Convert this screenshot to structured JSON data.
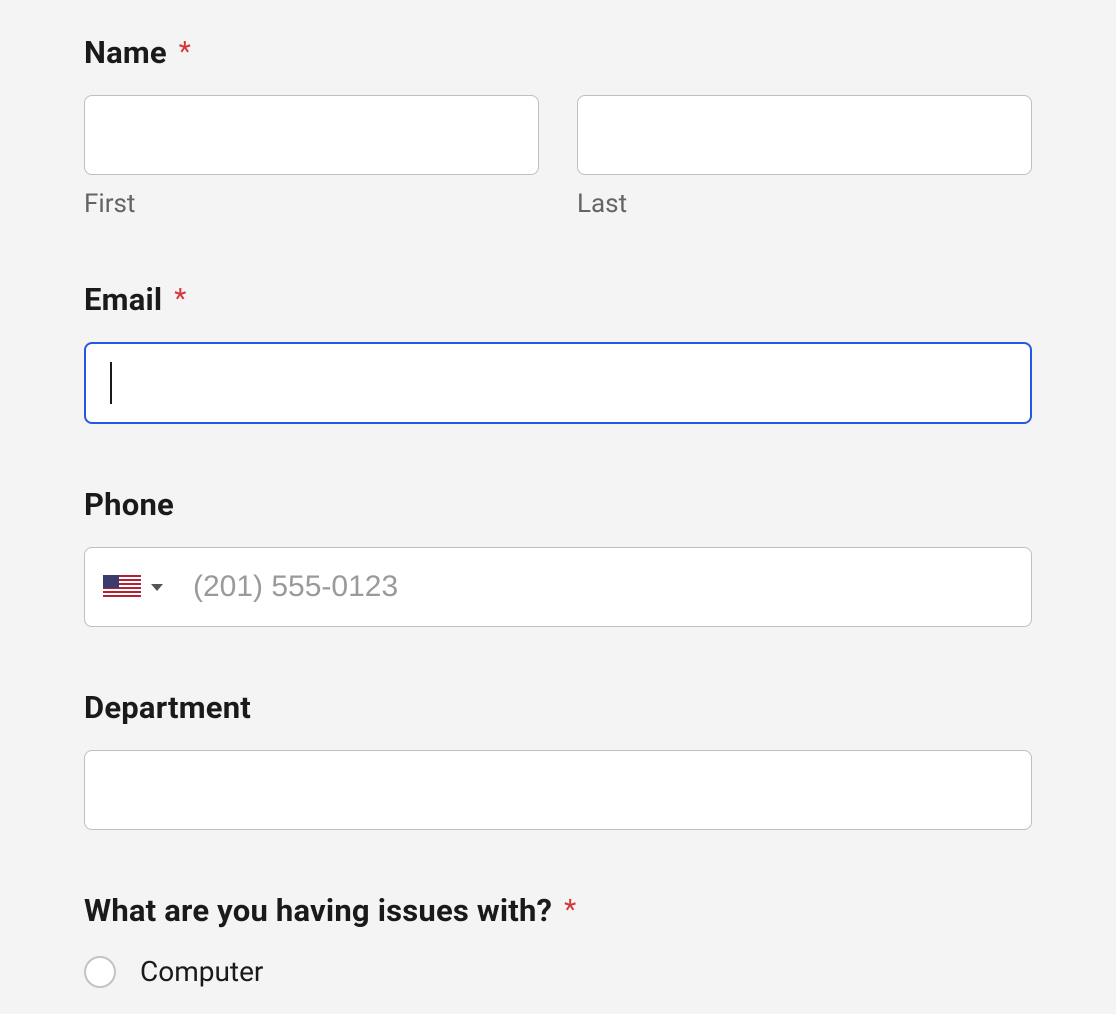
{
  "name": {
    "label": "Name",
    "first_sublabel": "First",
    "last_sublabel": "Last",
    "first_value": "",
    "last_value": ""
  },
  "email": {
    "label": "Email",
    "value": ""
  },
  "phone": {
    "label": "Phone",
    "placeholder": "(201) 555-0123",
    "value": "",
    "country": "US"
  },
  "department": {
    "label": "Department",
    "value": ""
  },
  "issues": {
    "label": "What are you having issues with?",
    "options": [
      {
        "label": "Computer",
        "checked": false
      }
    ]
  },
  "required_marker": "*"
}
